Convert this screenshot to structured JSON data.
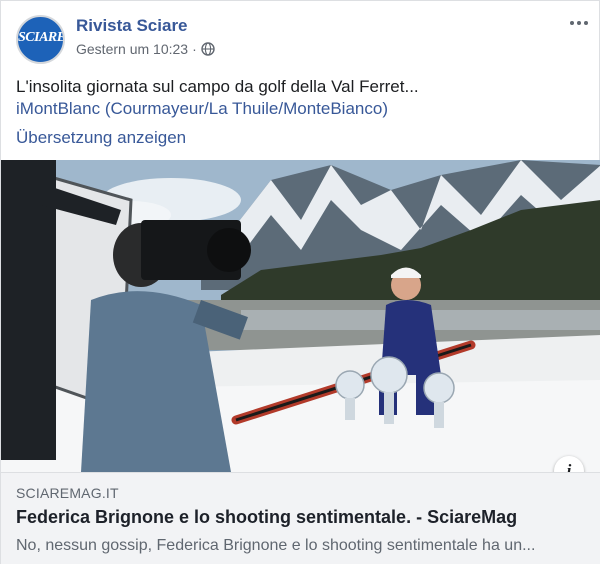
{
  "post": {
    "page_name": "Rivista Sciare",
    "avatar_text": "SCIARE",
    "timestamp": "Gestern um 10:23",
    "separator": "·",
    "audience_icon": "globe-icon",
    "text": "L'insolita giornata sul campo da golf della Val Ferret...",
    "hashtag_link": "iMontBlanc (Courmayeur/La Thuile/MonteBianco)",
    "translate_label": "Übersetzung anzeigen"
  },
  "link_preview": {
    "domain": "SCIAREMAG.IT",
    "title": "Federica Brignone e lo shooting sentimentale. - SciareMag",
    "description": "No, nessun gossip, Federica Brignone e lo shooting sentimentale ha un..."
  },
  "colors": {
    "link": "#385898",
    "avatar_bg": "#1d62b8",
    "preview_bg": "#f2f3f5"
  }
}
